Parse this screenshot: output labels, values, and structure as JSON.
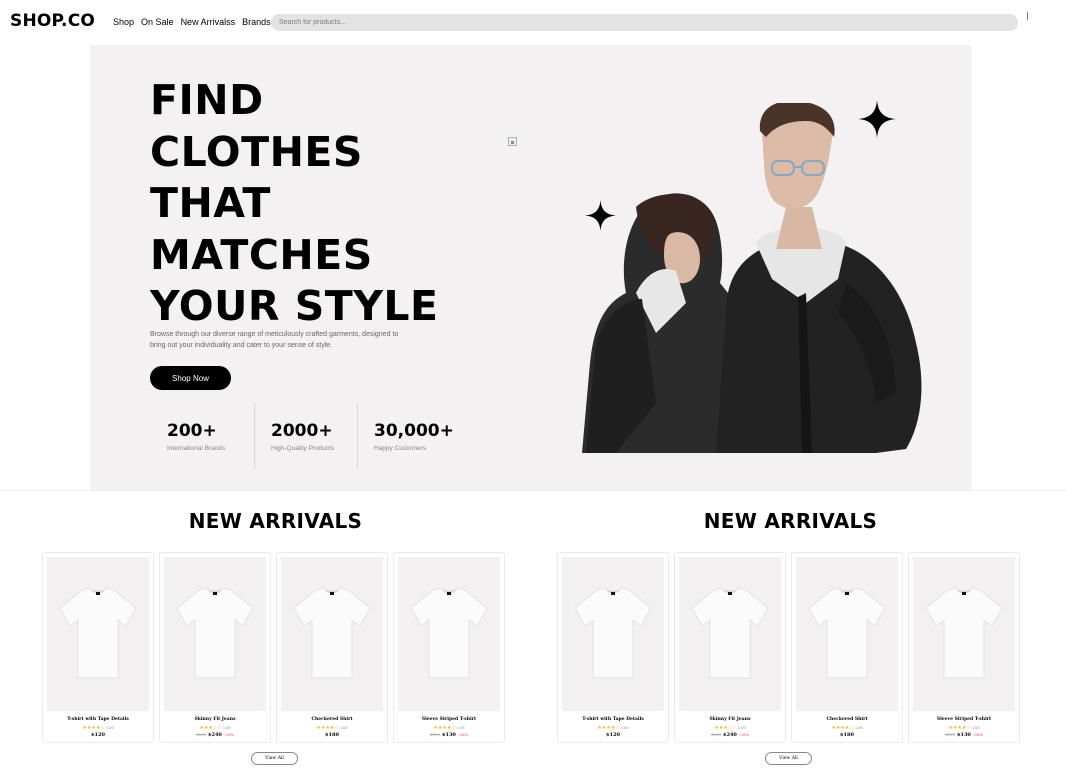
{
  "nav": {
    "logo": "SHOP.CO",
    "links": [
      "Shop",
      "On Sale",
      "New Arrivalss",
      "Brands"
    ],
    "search_placeholder": "Search for products..."
  },
  "hero": {
    "title_lines": [
      "FIND",
      "CLOTHES",
      "THAT",
      "MATCHES",
      "YOUR STYLE"
    ],
    "description": "Browse through our diverse range of meticulously crafted garments, designed to bring out your individuality and cater to your sense of style.",
    "cta_label": "Shop Now",
    "stats": [
      {
        "value": "200+",
        "label": "International Brands"
      },
      {
        "value": "2000+",
        "label": "High-Quality Products"
      },
      {
        "value": "30,000+",
        "label": "Happy Customers"
      }
    ]
  },
  "sections": [
    {
      "title": "NEW ARRIVALS",
      "view_all_label": "View All",
      "products": [
        {
          "name": "T-shirt with Tape Details",
          "stars": "★★★★☆",
          "rating": "4.5/5",
          "old_price": "",
          "price": "$120",
          "discount": ""
        },
        {
          "name": "Skinny Fit Jeans",
          "stars": "★★★☆☆",
          "rating": "3.5/5",
          "old_price": "$260",
          "price": "$240",
          "discount": "-20%"
        },
        {
          "name": "Checkered Shirt",
          "stars": "★★★★☆",
          "rating": "4.5/5",
          "old_price": "",
          "price": "$180",
          "discount": ""
        },
        {
          "name": "Sleeve Striped T-shirt",
          "stars": "★★★★☆",
          "rating": "4.5/5",
          "old_price": "$160",
          "price": "$130",
          "discount": "-30%"
        }
      ]
    },
    {
      "title": "NEW ARRIVALS",
      "view_all_label": "View All",
      "products": [
        {
          "name": "T-shirt with Tape Details",
          "stars": "★★★★☆",
          "rating": "4.5/5",
          "old_price": "",
          "price": "$120",
          "discount": ""
        },
        {
          "name": "Skinny Fit Jeans",
          "stars": "★★★☆☆",
          "rating": "3.5/5",
          "old_price": "$260",
          "price": "$240",
          "discount": "-20%"
        },
        {
          "name": "Checkered Shirt",
          "stars": "★★★★☆",
          "rating": "4.5/5",
          "old_price": "",
          "price": "$180",
          "discount": ""
        },
        {
          "name": "Sleeve Striped T-shirt",
          "stars": "★★★★☆",
          "rating": "4.5/5",
          "old_price": "$160",
          "price": "$130",
          "discount": "-30%"
        }
      ]
    }
  ],
  "colors": {
    "hero_bg": "#f3f1f2",
    "accent": "#000000",
    "star": "#f0b82e",
    "discount": "#e03b3b"
  },
  "icons": [
    "cart-icon",
    "sparkle-icon",
    "tshirt-icon",
    "broken-image-icon"
  ]
}
